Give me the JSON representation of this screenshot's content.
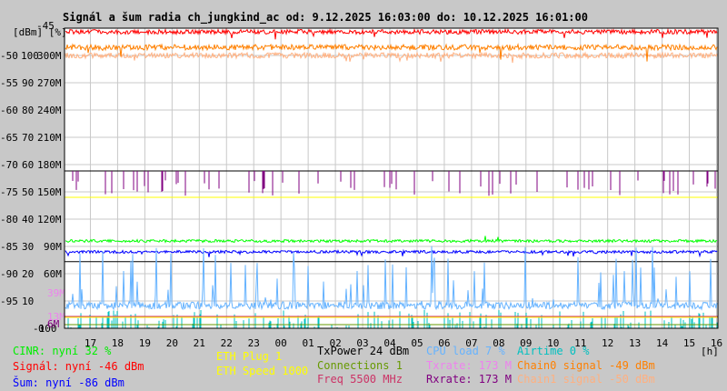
{
  "chart_data": {
    "type": "line",
    "title": "Signál a šum radia ch_jungkind_ac od: 9.12.2025 16:03:00 do: 10.12.2025 16:01:00",
    "y_units_label": "[dBm] [%]",
    "x_unit": "[h]",
    "ylim_dbm": [
      -100,
      -45
    ],
    "yticks_dbm": [
      "-45",
      "-50",
      "-55",
      "-60",
      "-65",
      "-70",
      "-75",
      "-80",
      "-85",
      "-90",
      "-95",
      "-100"
    ],
    "yticks_pct": [
      "100",
      "90",
      "80",
      "70",
      "60",
      "50",
      "40",
      "30",
      "20",
      "10",
      "0"
    ],
    "yticks_rate": [
      "300M",
      "270M",
      "240M",
      "210M",
      "180M",
      "150M",
      "120M",
      "90M",
      "60M"
    ],
    "rate_marks": [
      {
        "label": "39M",
        "color": "#ee82ee"
      },
      {
        "label": "13M",
        "color": "#ee82ee"
      },
      {
        "label": "6M",
        "color": "#800080"
      }
    ],
    "xticks": [
      "17",
      "18",
      "19",
      "20",
      "21",
      "22",
      "23",
      "00",
      "01",
      "02",
      "03",
      "04",
      "05",
      "06",
      "07",
      "08",
      "09",
      "10",
      "11",
      "12",
      "13",
      "14",
      "15",
      "16"
    ],
    "series": [
      {
        "name": "Signál",
        "level_dbm": -46,
        "color": "#ff0000"
      },
      {
        "name": "Chain0 signal",
        "level_dbm": -49,
        "color": "#ff8000"
      },
      {
        "name": "Chain1 signal",
        "level_dbm": -50,
        "color": "#ffb080"
      },
      {
        "name": "Rxrate",
        "level_mbps": 173,
        "color": "#800080"
      },
      {
        "name": "ETH Speed",
        "level_pct": 48,
        "color": "#ffff00"
      },
      {
        "name": "CINR",
        "level_pct": 32,
        "color": "#00ff00"
      },
      {
        "name": "Šum",
        "level_dbm": -86,
        "color": "#0000ff"
      },
      {
        "name": "TxPower",
        "level_dbm": -87.8,
        "color": "#000000"
      },
      {
        "name": "CPU load",
        "level_pct": 7,
        "color": "#66b3ff"
      },
      {
        "name": "Airtime",
        "level_pct": 0,
        "color": "#00c0c0"
      },
      {
        "name": "Txrate",
        "level_mbps": 13,
        "color": "#ee82ee"
      }
    ]
  },
  "legend": [
    {
      "text": "CINR: nyní 32 %",
      "color": "#00ee00"
    },
    {
      "text": "Signál: nyní -46 dBm",
      "color": "#ff0000"
    },
    {
      "text": "Šum: nyní -86 dBm",
      "color": "#0000ff"
    },
    {
      "text": "ETH Plug 1",
      "color": "#ffff00"
    },
    {
      "text": "ETH Speed 1000",
      "color": "#ffff00"
    },
    {
      "text": "TxPower 24 dBm",
      "color": "#000000"
    },
    {
      "text": "Connections 1",
      "color": "#669900"
    },
    {
      "text": "Freq 5500 MHz",
      "color": "#cc3366"
    },
    {
      "text": "CPU load 7 %",
      "color": "#66b3ff"
    },
    {
      "text": "Txrate: 173 M",
      "color": "#ee82ee"
    },
    {
      "text": "Rxrate: 173 M",
      "color": "#800080"
    },
    {
      "text": "Airtime 0 %",
      "color": "#00c0c0"
    },
    {
      "text": "Chain0 signal -49 dBm",
      "color": "#ff8000"
    },
    {
      "text": "Chain1 signal -50 dBm",
      "color": "#ffb080"
    }
  ]
}
